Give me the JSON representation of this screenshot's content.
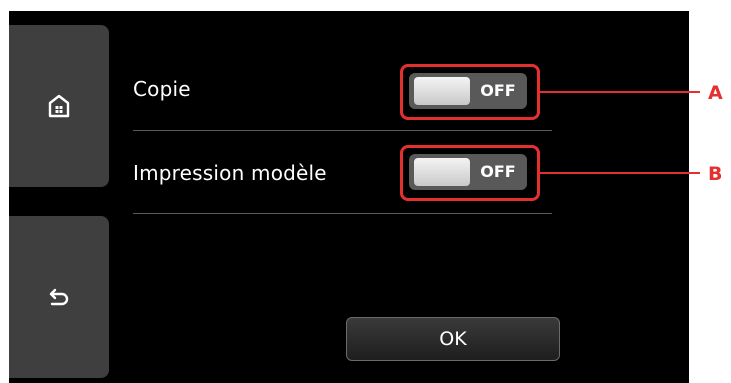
{
  "settings": [
    {
      "label": "Copie",
      "toggle_state": "OFF",
      "callout": "A"
    },
    {
      "label": "Impression modèle",
      "toggle_state": "OFF",
      "callout": "B"
    }
  ],
  "footer": {
    "ok_label": "OK"
  },
  "icons": {
    "home": "home-icon",
    "back": "back-arrow-icon"
  },
  "colors": {
    "screen_bg": "#000000",
    "side_button": "#3f3f3f",
    "callout": "#e53030",
    "toggle_bg": "#595959"
  }
}
